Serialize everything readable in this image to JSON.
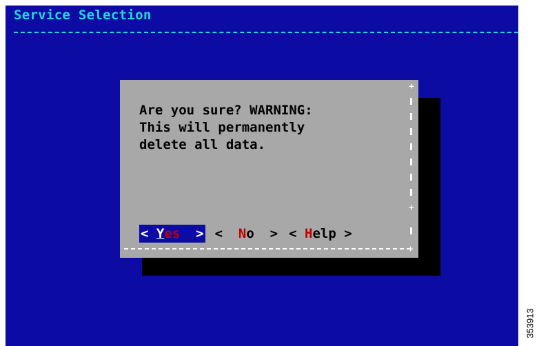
{
  "screen": {
    "title": "Service Selection"
  },
  "dialog": {
    "message_lines": [
      "Are you sure? WARNING:",
      "This will permanently",
      "delete all data."
    ],
    "buttons": [
      {
        "open": "< ",
        "hotkey": "Y",
        "rest": "es",
        "close": "  >",
        "selected": true
      },
      {
        "open": "<  ",
        "hotkey": "N",
        "rest": "o",
        "close": "  >",
        "selected": false
      },
      {
        "open": "< ",
        "hotkey": "H",
        "rest": "elp",
        "close": " >",
        "selected": false
      }
    ]
  },
  "figure_id": "353913",
  "colors": {
    "screen_background": "#0c0ca4",
    "title_text": "#26d6d6",
    "dialog_background": "#a8a8a8",
    "hotkey": "#c00000",
    "shadow": "#000000"
  }
}
